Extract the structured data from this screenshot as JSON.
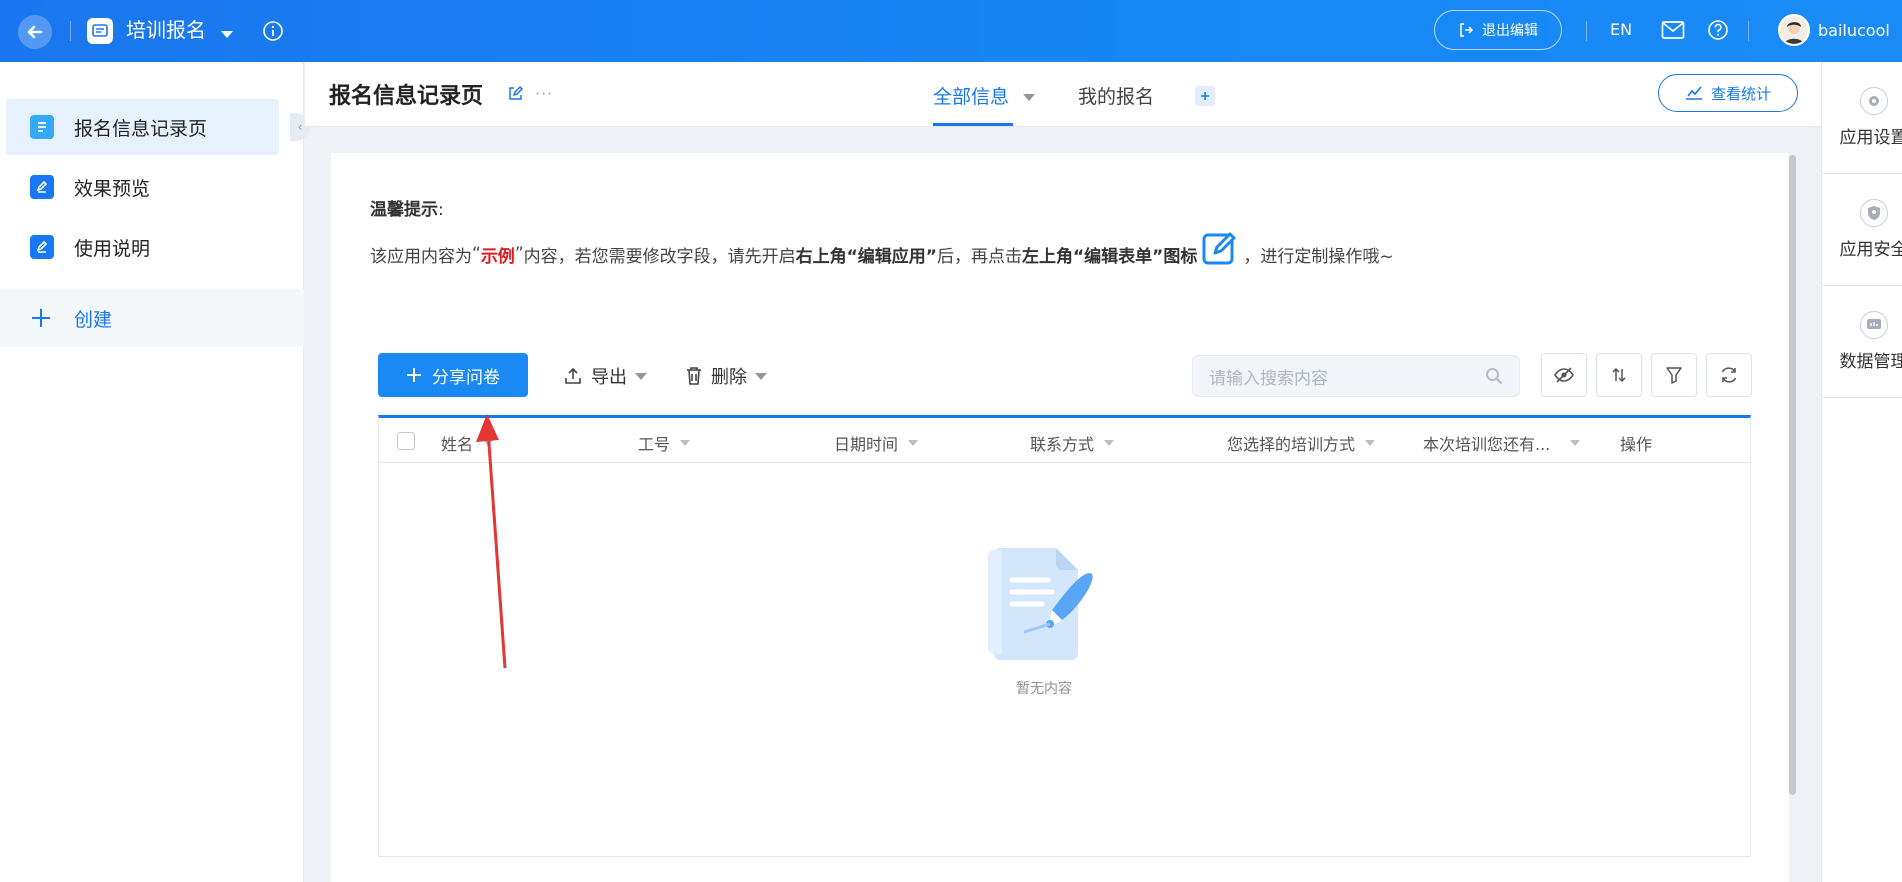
{
  "topbar": {
    "app_title": "培训报名",
    "exit_edit_label": "退出编辑",
    "language_label": "EN",
    "username": "bailucool"
  },
  "sidebar": {
    "items": [
      {
        "label": "报名信息记录页"
      },
      {
        "label": "效果预览"
      },
      {
        "label": "使用说明"
      }
    ],
    "create_label": "创建"
  },
  "header": {
    "page_title": "报名信息记录页",
    "tabs": [
      {
        "label": "全部信息"
      },
      {
        "label": "我的报名"
      }
    ],
    "stats_label": "查看统计"
  },
  "right_panel": {
    "items": [
      {
        "label": "应用设置"
      },
      {
        "label": "应用安全"
      },
      {
        "label": "数据管理"
      }
    ]
  },
  "tip": {
    "title": "温馨提示",
    "title_colon": ":",
    "seg1": "该应用内容为",
    "q_open": "“",
    "example": "示例",
    "q_close": "”",
    "seg2": "内容，若您需要修改字段，请先开启",
    "bold1": "右上角“编辑应用”",
    "seg3": "后，再点击",
    "bold2": "左上角“编辑表单”图标",
    "seg4": "，进行定制操作哦~"
  },
  "toolbar": {
    "share_label": "分享问卷",
    "export_label": "导出",
    "delete_label": "删除",
    "search_placeholder": "请输入搜索内容"
  },
  "table": {
    "columns": [
      "姓名",
      "工号",
      "日期时间",
      "联系方式",
      "您选择的培训方式",
      "本次培训您还有...",
      "操作"
    ],
    "empty_text": "暂无内容"
  },
  "colors": {
    "primary": "#1878f3",
    "accent_red": "#e5181f",
    "annotation_arrow": "#e53535"
  }
}
